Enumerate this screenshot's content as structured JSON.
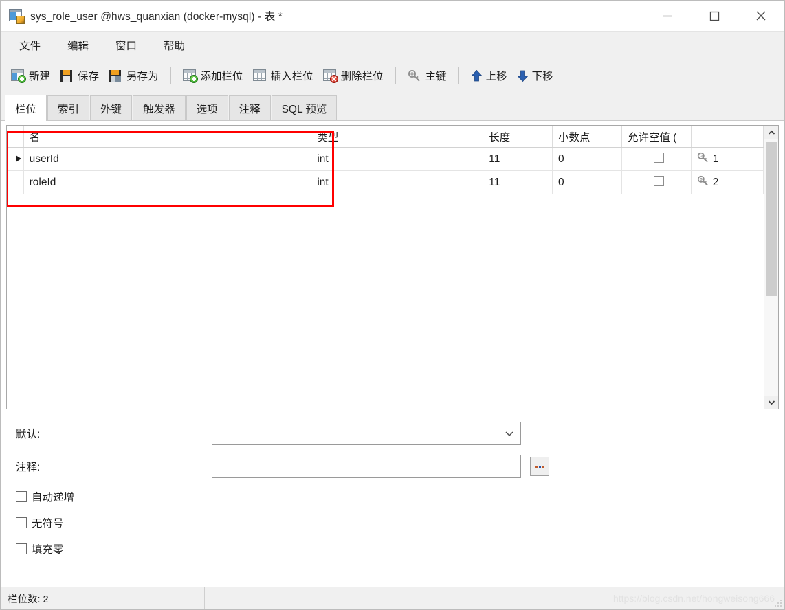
{
  "window": {
    "title": "sys_role_user @hws_quanxian (docker-mysql) - 表 *",
    "icon": "table-edit-icon",
    "controls": {
      "minimize": "minimize-icon",
      "maximize": "maximize-icon",
      "close": "close-icon"
    }
  },
  "menubar": {
    "items": [
      {
        "label": "文件"
      },
      {
        "label": "编辑"
      },
      {
        "label": "窗口"
      },
      {
        "label": "帮助"
      }
    ]
  },
  "toolbar": {
    "items": [
      {
        "label": "新建",
        "icon": "new-table-icon"
      },
      {
        "label": "保存",
        "icon": "save-icon"
      },
      {
        "label": "另存为",
        "icon": "save-as-icon"
      },
      {
        "label": "添加栏位",
        "icon": "add-field-icon"
      },
      {
        "label": "插入栏位",
        "icon": "insert-field-icon"
      },
      {
        "label": "删除栏位",
        "icon": "delete-field-icon"
      },
      {
        "label": "主键",
        "icon": "primary-key-icon"
      },
      {
        "label": "上移",
        "icon": "arrow-up-icon"
      },
      {
        "label": "下移",
        "icon": "arrow-down-icon"
      }
    ]
  },
  "tabs": {
    "items": [
      {
        "label": "栏位",
        "active": true
      },
      {
        "label": "索引",
        "active": false
      },
      {
        "label": "外键",
        "active": false
      },
      {
        "label": "触发器",
        "active": false
      },
      {
        "label": "选项",
        "active": false
      },
      {
        "label": "注释",
        "active": false
      },
      {
        "label": "SQL 预览",
        "active": false
      }
    ]
  },
  "grid": {
    "columns": [
      "名",
      "类型",
      "长度",
      "小数点",
      "允许空值 ("
    ],
    "rows": [
      {
        "selected": true,
        "name": "userId",
        "type": "int",
        "length": "11",
        "decimals": "0",
        "nullable": false,
        "key_icon": "key-icon",
        "key_order": "1"
      },
      {
        "selected": false,
        "name": "roleId",
        "type": "int",
        "length": "11",
        "decimals": "0",
        "nullable": false,
        "key_icon": "key-icon",
        "key_order": "2"
      }
    ],
    "annotation": {
      "color": "#ff0000",
      "shape": "rectangle"
    },
    "scrollbar": {
      "up_icon": "chevron-up-icon",
      "down_icon": "chevron-down-icon"
    }
  },
  "form": {
    "default_label": "默认:",
    "default_value": "",
    "comment_label": "注释:",
    "comment_value": "",
    "browse_button": "ellipsis-button",
    "checkboxes": [
      {
        "label": "自动递增",
        "checked": false
      },
      {
        "label": "无符号",
        "checked": false
      },
      {
        "label": "填充零",
        "checked": false
      }
    ]
  },
  "statusbar": {
    "field_count": "栏位数: 2",
    "watermark": "https://blog.csdn.net/hongweisong666"
  }
}
